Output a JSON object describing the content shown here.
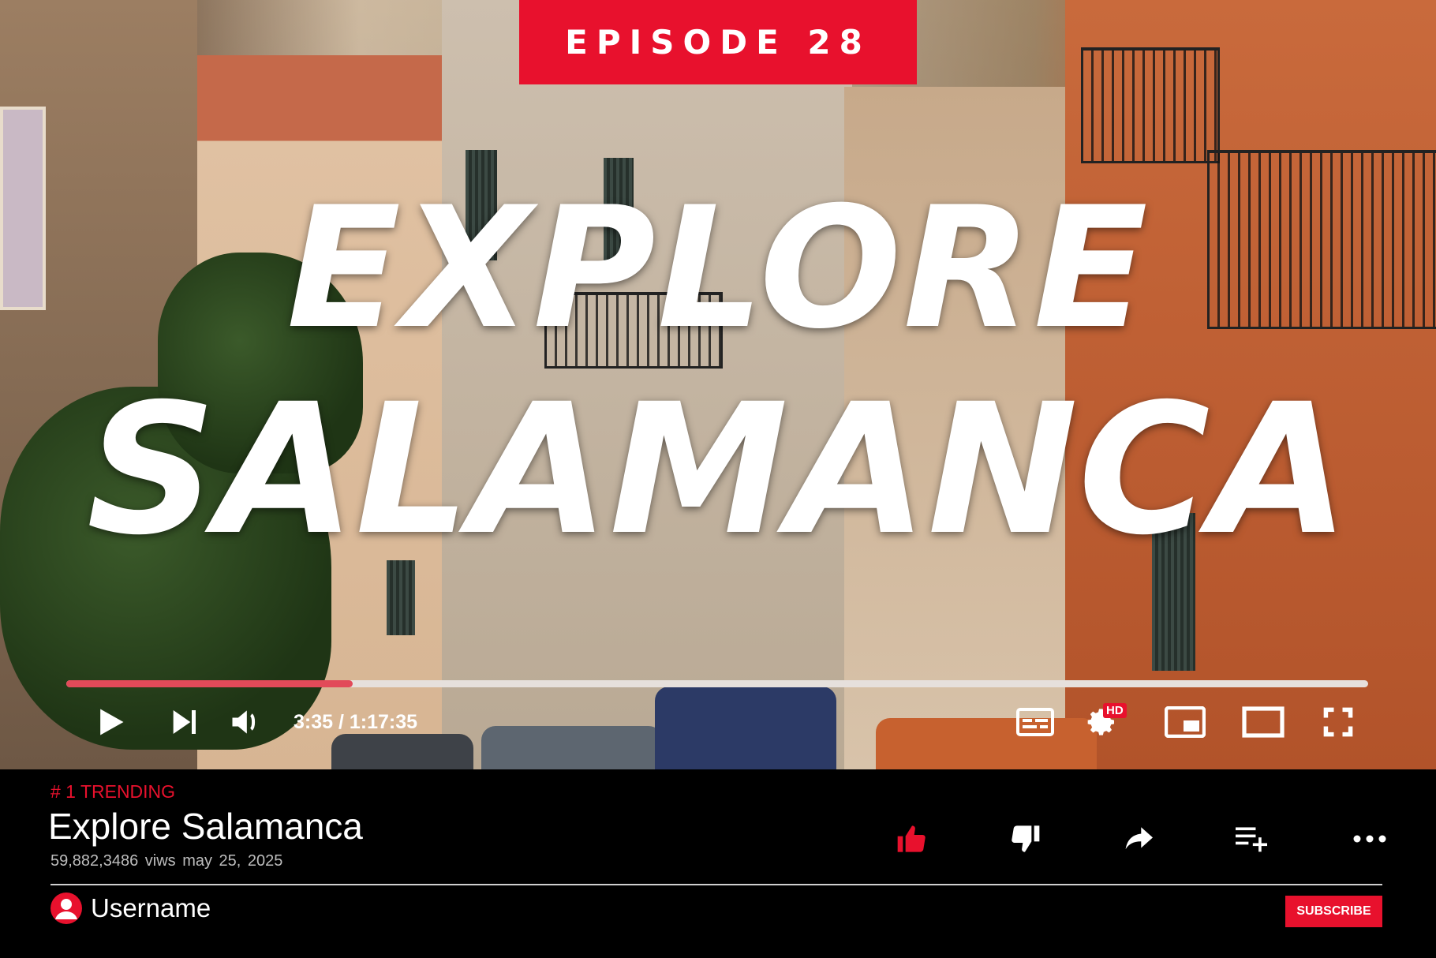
{
  "episode": {
    "label": "EPISODE 28"
  },
  "overlay_title": {
    "line1": "EXPLORE",
    "line2": "SALAMANCA"
  },
  "player": {
    "progress_fraction": 0.22,
    "time_display": "3:35 / 1:17:35",
    "hd_badge": "HD",
    "controls": [
      "play-icon",
      "next-icon",
      "volume-icon",
      "subtitles-icon",
      "settings-icon",
      "miniplayer-icon",
      "theater-icon",
      "fullscreen-icon"
    ]
  },
  "video_info": {
    "trending": "# 1 TRENDING",
    "title": "Explore Salamanca",
    "meta": "59,882,3486 viws  may  25, 2025"
  },
  "actions": [
    "like-icon",
    "dislike-icon",
    "share-icon",
    "add-to-playlist-icon",
    "more-icon"
  ],
  "channel": {
    "username": "Username",
    "subscribe_label": "SUBSCRIBE"
  },
  "colors": {
    "accent": "#e8112d",
    "progress": "#e24a59",
    "background": "#000000"
  }
}
